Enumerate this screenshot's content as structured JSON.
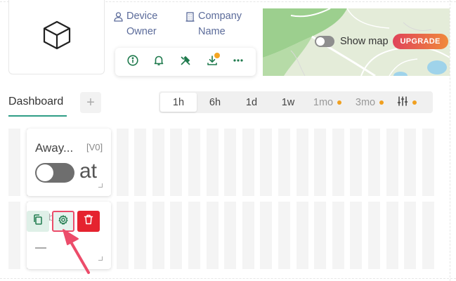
{
  "device": {
    "image_icon": "cube-icon",
    "owner_label": "Device\nOwner",
    "owner_line1": "Device",
    "owner_line2": "Owner",
    "company_line1": "Company",
    "company_line2": "Name",
    "owner_icon": "user-icon",
    "company_icon": "building-icon"
  },
  "actions": [
    {
      "name": "info-button",
      "icon": "info-icon"
    },
    {
      "name": "notifications-button",
      "icon": "bell-icon"
    },
    {
      "name": "tools-button",
      "icon": "tools-icon"
    },
    {
      "name": "download-button",
      "icon": "download-icon",
      "badge": true
    },
    {
      "name": "more-button",
      "icon": "more-horizontal-icon"
    }
  ],
  "map": {
    "show_map_label": "Show map",
    "show_map_on": false,
    "upgrade_label": "UPGRADE"
  },
  "tabs": {
    "dashboard_label": "Dashboard",
    "add_label": "+"
  },
  "time_range": {
    "options": [
      {
        "label": "1h",
        "active": true,
        "locked": false
      },
      {
        "label": "6h",
        "active": false,
        "locked": false
      },
      {
        "label": "1d",
        "active": false,
        "locked": false
      },
      {
        "label": "1w",
        "active": false,
        "locked": false
      },
      {
        "label": "1mo",
        "active": false,
        "locked": true
      },
      {
        "label": "3mo",
        "active": false,
        "locked": true
      }
    ],
    "filter_icon": "sliders-icon"
  },
  "widgets": {
    "widget1": {
      "title": "Away...",
      "version": "[V0]",
      "toggle_on": false,
      "value": "at"
    },
    "widget2": {
      "hint": "b",
      "value": "—",
      "copy_icon": "copy-icon",
      "settings_icon": "gear-icon",
      "delete_icon": "trash-icon"
    }
  },
  "colors": {
    "accent": "#2f9e86",
    "link_blue": "#5b6b9a",
    "badge_orange": "#f5a623",
    "delete_red": "#e5232f",
    "highlight_pink": "#ec4c6a"
  }
}
